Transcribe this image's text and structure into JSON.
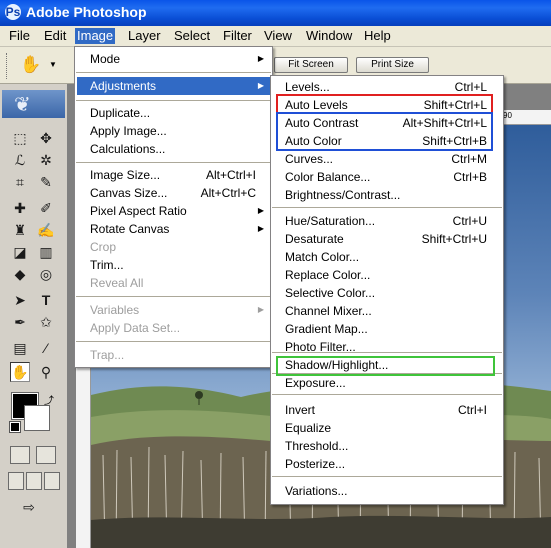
{
  "app": {
    "title": "Adobe Photoshop",
    "logo": "Ps"
  },
  "menubar": [
    {
      "label": "File"
    },
    {
      "label": "Edit"
    },
    {
      "label": "Image"
    },
    {
      "label": "Layer"
    },
    {
      "label": "Select"
    },
    {
      "label": "Filter"
    },
    {
      "label": "View"
    },
    {
      "label": "Window"
    },
    {
      "label": "Help"
    }
  ],
  "options_bar": {
    "hand_icon": "hand-icon",
    "buttons": [
      "Fit Screen",
      "Print Size"
    ]
  },
  "image_menu": [
    {
      "label": "Mode",
      "shortcut": "",
      "arrow": "▶",
      "enabled": true
    },
    {
      "label": "Adjustments",
      "shortcut": "",
      "arrow": "▶",
      "enabled": true,
      "highlighted": true
    },
    {
      "label": "Duplicate...",
      "shortcut": "",
      "enabled": true
    },
    {
      "label": "Apply Image...",
      "shortcut": "",
      "enabled": true
    },
    {
      "label": "Calculations...",
      "shortcut": "",
      "enabled": true
    },
    {
      "label": "Image Size...",
      "shortcut": "Alt+Ctrl+I",
      "enabled": true
    },
    {
      "label": "Canvas Size...",
      "shortcut": "Alt+Ctrl+C",
      "enabled": true
    },
    {
      "label": "Pixel Aspect Ratio",
      "shortcut": "",
      "arrow": "▶",
      "enabled": true
    },
    {
      "label": "Rotate Canvas",
      "shortcut": "",
      "arrow": "▶",
      "enabled": true
    },
    {
      "label": "Crop",
      "shortcut": "",
      "enabled": false
    },
    {
      "label": "Trim...",
      "shortcut": "",
      "enabled": true
    },
    {
      "label": "Reveal All",
      "shortcut": "",
      "enabled": false
    },
    {
      "label": "Variables",
      "shortcut": "",
      "arrow": "▶",
      "enabled": false
    },
    {
      "label": "Apply Data Set...",
      "shortcut": "",
      "enabled": false
    },
    {
      "label": "Trap...",
      "shortcut": "",
      "enabled": false
    }
  ],
  "adjustments_menu": [
    {
      "label": "Levels...",
      "shortcut": "Ctrl+L"
    },
    {
      "label": "Auto Levels",
      "shortcut": "Shift+Ctrl+L"
    },
    {
      "label": "Auto Contrast",
      "shortcut": "Alt+Shift+Ctrl+L"
    },
    {
      "label": "Auto Color",
      "shortcut": "Shift+Ctrl+B"
    },
    {
      "label": "Curves...",
      "shortcut": "Ctrl+M"
    },
    {
      "label": "Color Balance...",
      "shortcut": "Ctrl+B"
    },
    {
      "label": "Brightness/Contrast...",
      "shortcut": ""
    },
    {
      "label": "Hue/Saturation...",
      "shortcut": "Ctrl+U"
    },
    {
      "label": "Desaturate",
      "shortcut": "Shift+Ctrl+U"
    },
    {
      "label": "Match Color...",
      "shortcut": ""
    },
    {
      "label": "Replace Color...",
      "shortcut": ""
    },
    {
      "label": "Selective Color...",
      "shortcut": ""
    },
    {
      "label": "Channel Mixer...",
      "shortcut": ""
    },
    {
      "label": "Gradient Map...",
      "shortcut": ""
    },
    {
      "label": "Photo Filter...",
      "shortcut": ""
    },
    {
      "label": "Shadow/Highlight...",
      "shortcut": ""
    },
    {
      "label": "Exposure...",
      "shortcut": ""
    },
    {
      "label": "Invert",
      "shortcut": "Ctrl+I"
    },
    {
      "label": "Equalize",
      "shortcut": ""
    },
    {
      "label": "Threshold...",
      "shortcut": ""
    },
    {
      "label": "Posterize...",
      "shortcut": ""
    },
    {
      "label": "Variations...",
      "shortcut": ""
    }
  ],
  "ruler": {
    "top_label": "90"
  },
  "highlight_colors": {
    "red": "#e02020",
    "blue": "#1f4fd6",
    "green": "#3fc43a"
  }
}
